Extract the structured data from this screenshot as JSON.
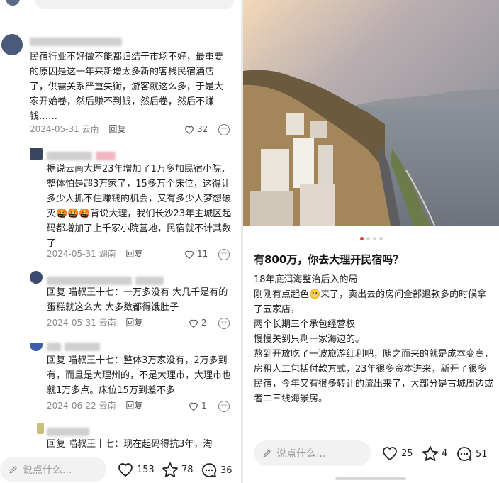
{
  "left": {
    "comments": [
      {
        "text": "民宿行业不好做不能都归结于市场不好，最重要的原因是这一年来新增太多新的客栈民宿酒店了，供需关系严重失衡，游客就这么多，于是大家开始卷，然后赚不到钱，然后卷，然后不赚钱……",
        "date": "2024-05-31",
        "location": "云南",
        "reply": "回复",
        "likes": "32"
      },
      {
        "text": "据说云南大理23年增加了1万多加民宿小院，整体怕是超3万家了，15多万个床位，这得让多少人抓不住赚钱的机会，又有多少人梦想破灭🤬🤬🤬背说大理，我们长沙23年主城区起码都增加了上千家小院营地，民宿就不计其数了",
        "date": "2024-05-31",
        "location": "湖南",
        "reply": "回复",
        "likes": "11"
      },
      {
        "text": "回复 喵叔王十七：一万多没有 大几千是有的 蛋糕就这么大 大多数都得饿肚子",
        "date": "2024-05-31",
        "location": "云南",
        "reply": "回复",
        "likes": "2"
      },
      {
        "text": "回复 喵叔王十七：整体3万家没有，2万多到有，而且是大理州的，不是大理市，大理市也就1万多点。床位15万到差不多",
        "date": "2024-06-22",
        "location": "云南",
        "reply": "回复",
        "likes": "1"
      },
      {
        "text": "回复 喵叔王十七：现在起码得抗3年，淘"
      }
    ],
    "bottom": {
      "placeholder": "说点什么...",
      "likes": "153",
      "stars": "78",
      "comments": "36"
    }
  },
  "right": {
    "post_title": "有800万，你去大理开民宿吗？",
    "post_lines": [
      "18年底洱海整治后入的局",
      "刚刚有点起色😬来了，卖出去的房间全部退款多的时候拿了五家店，",
      "两个长期三个承包经营权",
      "慢慢关到只剩一家海边的。",
      "熬到开放吃了一波旅游红利吧，随之而来的就是成本变高，房租人工包括付款方式，23年很多资本进来，新开了很多民宿，今年又有很多转让的流出来了，大部分是古城周边或者二三线海景房。"
    ],
    "bottom": {
      "placeholder": "说点什么...",
      "likes": "25",
      "stars": "4",
      "comments": "51"
    }
  },
  "colors": {
    "accent": "#e23c3c",
    "muted": "#8a8a8a",
    "input_bg": "#f2f2f2"
  }
}
